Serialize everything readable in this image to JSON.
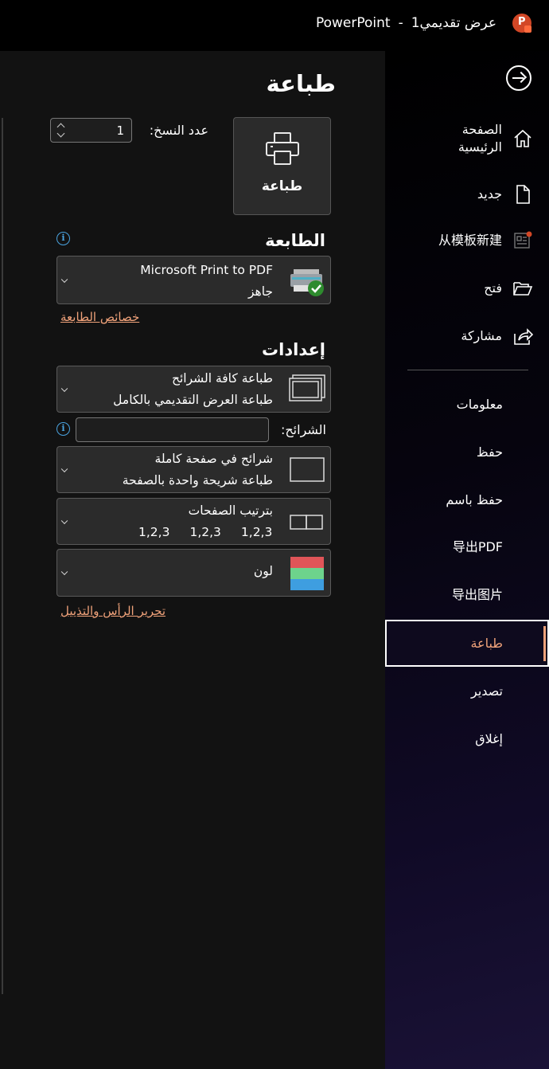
{
  "titlebar": {
    "app_name": "PowerPoint",
    "separator": "-",
    "document_name": "عرض تقديمي1"
  },
  "sidebar": {
    "items": [
      {
        "label": "الصفحة الرئيسية",
        "icon": "home-icon"
      },
      {
        "label": "جديد",
        "icon": "new-doc-icon"
      },
      {
        "label": "从模板新建",
        "icon": "template-icon"
      },
      {
        "label": "فتح",
        "icon": "folder-open-icon"
      },
      {
        "label": "مشاركة",
        "icon": "share-icon"
      }
    ],
    "secondary": [
      {
        "label": "معلومات"
      },
      {
        "label": "حفظ"
      },
      {
        "label": "حفظ باسم"
      },
      {
        "label": "导出PDF"
      },
      {
        "label": "导出图片"
      },
      {
        "label": "طباعة",
        "active": true
      },
      {
        "label": "تصدير"
      },
      {
        "label": "إغلاق"
      }
    ],
    "accent_color": "#f0a27a"
  },
  "print": {
    "heading": "طباعة",
    "button_label": "طباعة",
    "copies_label": "عدد النسخ:",
    "copies_value": "1"
  },
  "printer": {
    "heading": "الطابعة",
    "name": "Microsoft Print to PDF",
    "status": "جاهز",
    "properties_link": "خصائص الطابعة"
  },
  "settings": {
    "heading": "إعدادات",
    "slides_range": {
      "line1": "طباعة كافة الشرائح",
      "line2": "طباعة العرض التقديمي بالكامل"
    },
    "slides_label": "الشرائح:",
    "slides_input": "",
    "layout": {
      "line1": "شرائح في صفحة كاملة",
      "line2": "طباعة شريحة واحدة بالصفحة"
    },
    "collation": {
      "line1": "بترتيب الصفحات",
      "nums": [
        "1,2,3",
        "1,2,3",
        "1,2,3"
      ]
    },
    "color": {
      "line1": "لون"
    },
    "header_footer_link": "تحرير الرأس والتذييل"
  }
}
